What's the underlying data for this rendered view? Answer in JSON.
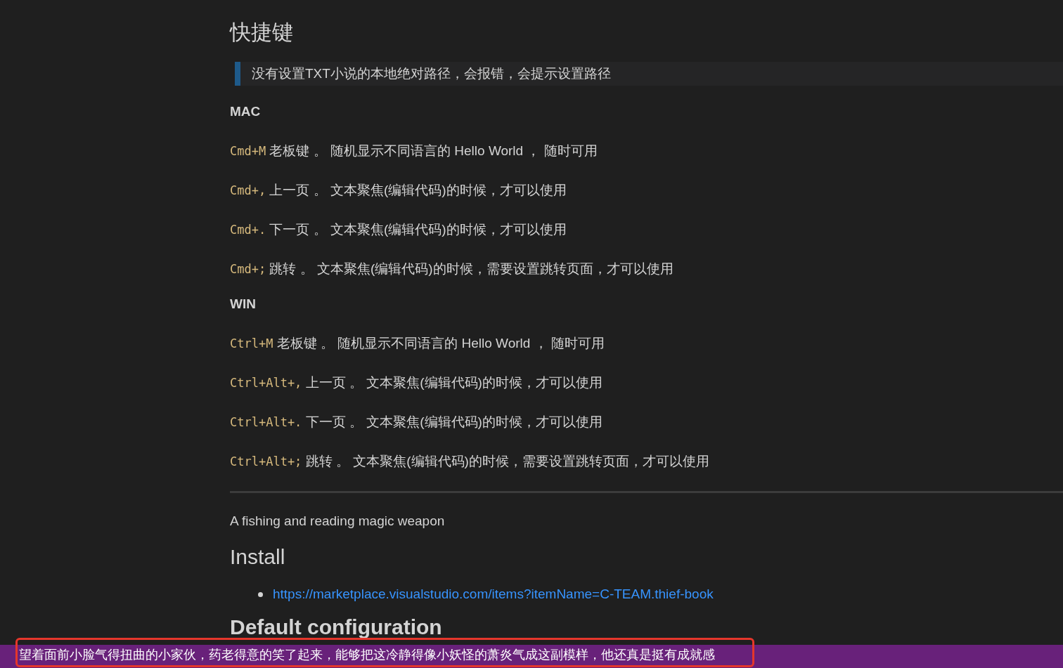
{
  "heading": "快捷键",
  "blockquote": "没有设置TXT小说的本地绝对路径，会报错，会提示设置路径",
  "sections": [
    {
      "title": "MAC",
      "shortcuts": [
        {
          "keys": "Cmd+M",
          "text": "老板键 。 随机显示不同语言的 Hello World ， 随时可用"
        },
        {
          "keys": "Cmd+,",
          "text": "上一页 。 文本聚焦(编辑代码)的时候，才可以使用"
        },
        {
          "keys": "Cmd+.",
          "text": "下一页 。 文本聚焦(编辑代码)的时候，才可以使用"
        },
        {
          "keys": "Cmd+;",
          "text": "跳转 。 文本聚焦(编辑代码)的时候，需要设置跳转页面，才可以使用"
        }
      ]
    },
    {
      "title": "WIN",
      "shortcuts": [
        {
          "keys": "Ctrl+M",
          "text": "老板键 。 随机显示不同语言的 Hello World ， 随时可用"
        },
        {
          "keys": "Ctrl+Alt+,",
          "text": "上一页 。 文本聚焦(编辑代码)的时候，才可以使用"
        },
        {
          "keys": "Ctrl+Alt+.",
          "text": "下一页 。 文本聚焦(编辑代码)的时候，才可以使用"
        },
        {
          "keys": "Ctrl+Alt+;",
          "text": "跳转 。 文本聚焦(编辑代码)的时候，需要设置跳转页面，才可以使用"
        }
      ]
    }
  ],
  "tagline": "A fishing and reading magic weapon",
  "install": {
    "title": "Install",
    "links": [
      "https://marketplace.visualstudio.com/items?itemName=C-TEAM.thief-book"
    ]
  },
  "next_heading": "Default configuration",
  "status_bar": {
    "text": "望着面前小脸气得扭曲的小家伙，药老得意的笑了起来，能够把这冷静得像小妖怪的萧炎气成这副模样，他还真是挺有成就感"
  }
}
